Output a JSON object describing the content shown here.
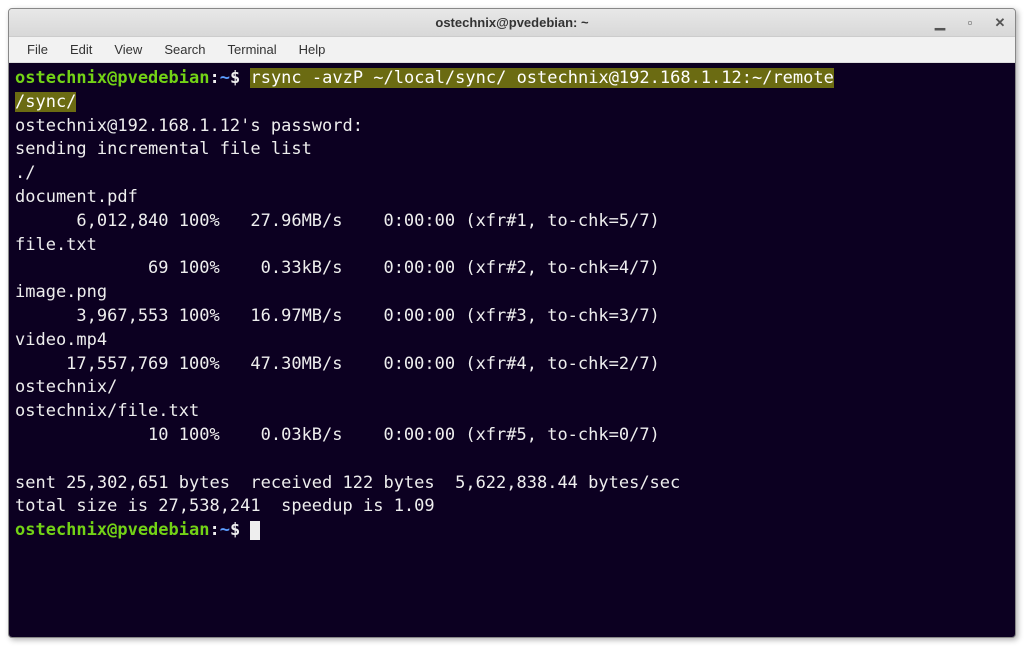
{
  "window": {
    "title": "ostechnix@pvedebian: ~",
    "controls": {
      "min": "▪",
      "max": "□",
      "close": "✕"
    }
  },
  "menu": {
    "file": "File",
    "edit": "Edit",
    "view": "View",
    "search": "Search",
    "terminal": "Terminal",
    "help": "Help"
  },
  "prompt": {
    "user": "ostechnix@pvedebian",
    "path": "~",
    "dollar": "$"
  },
  "command": {
    "hl1": "rsync -avzP ~/local/sync/ ostechnix@192.168.1.12:~/remote",
    "hl2": "/sync/"
  },
  "out": {
    "l1": "ostechnix@192.168.1.12's password:",
    "l2": "sending incremental file list",
    "l3": "./",
    "l4": "document.pdf",
    "l5": "      6,012,840 100%   27.96MB/s    0:00:00 (xfr#1, to-chk=5/7)",
    "l6": "file.txt",
    "l7": "             69 100%    0.33kB/s    0:00:00 (xfr#2, to-chk=4/7)",
    "l8": "image.png",
    "l9": "      3,967,553 100%   16.97MB/s    0:00:00 (xfr#3, to-chk=3/7)",
    "l10": "video.mp4",
    "l11": "     17,557,769 100%   47.30MB/s    0:00:00 (xfr#4, to-chk=2/7)",
    "l12": "ostechnix/",
    "l13": "ostechnix/file.txt",
    "l14": "             10 100%    0.03kB/s    0:00:00 (xfr#5, to-chk=0/7)",
    "l15": " ",
    "l16": "sent 25,302,651 bytes  received 122 bytes  5,622,838.44 bytes/sec",
    "l17": "total size is 27,538,241  speedup is 1.09"
  }
}
